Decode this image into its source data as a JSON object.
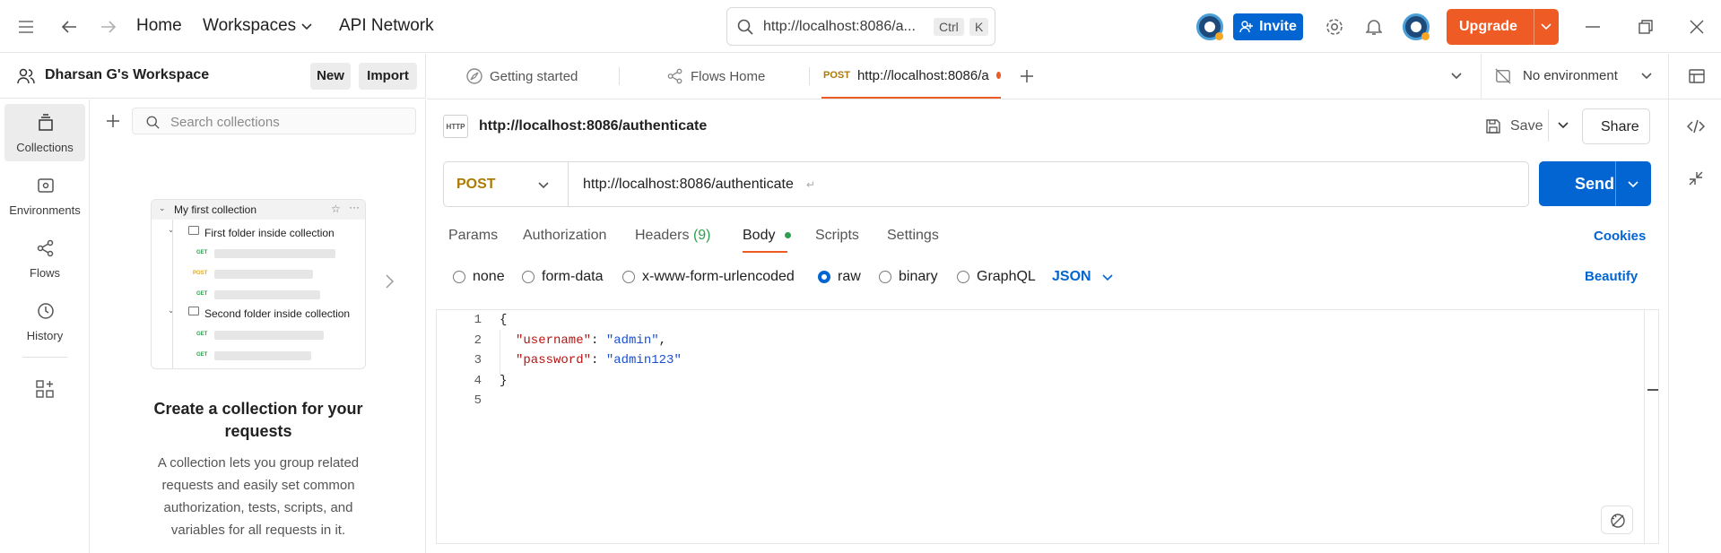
{
  "topbar": {
    "home": "Home",
    "workspaces": "Workspaces",
    "api_network": "API Network",
    "search_text": "http://localhost:8086/a...",
    "kbd_ctrl": "Ctrl",
    "kbd_k": "K",
    "invite": "Invite",
    "upgrade": "Upgrade",
    "accent_color": "#ef5b25",
    "primary_color": "#0265d2"
  },
  "rail": {
    "items": [
      {
        "label": "Collections",
        "icon": "collections-icon"
      },
      {
        "label": "Environments",
        "icon": "environments-icon"
      },
      {
        "label": "Flows",
        "icon": "flows-icon"
      },
      {
        "label": "History",
        "icon": "history-icon"
      }
    ]
  },
  "sidebar": {
    "workspace_name": "Dharsan G's Workspace",
    "new_label": "New",
    "import_label": "Import",
    "search_placeholder": "Search collections",
    "illustration": {
      "collection": "My first collection",
      "folder1": "First folder inside collection",
      "folder2": "Second folder inside collection",
      "get": "GET",
      "post": "POST"
    },
    "empty_title": "Create a collection for your requests",
    "empty_desc": "A collection lets you group related requests and easily set common authorization, tests, scripts, and variables for all requests in it."
  },
  "tabs": {
    "items": [
      {
        "label": "Getting started"
      },
      {
        "label": "Flows Home"
      },
      {
        "method": "POST",
        "label": "http://localhost:8086/a"
      }
    ],
    "environment": "No environment"
  },
  "request": {
    "title": "http://localhost:8086/authenticate",
    "save": "Save",
    "share": "Share",
    "method": "POST",
    "url": "http://localhost:8086/authenticate",
    "send": "Send",
    "subtabs": {
      "params": "Params",
      "authorization": "Authorization",
      "headers": "Headers",
      "headers_count": "(9)",
      "body": "Body",
      "scripts": "Scripts",
      "settings": "Settings"
    },
    "cookies": "Cookies",
    "body_types": [
      "none",
      "form-data",
      "x-www-form-urlencoded",
      "raw",
      "binary",
      "GraphQL"
    ],
    "body_format": "JSON",
    "beautify": "Beautify",
    "code": {
      "line_numbers": [
        "1",
        "2",
        "3",
        "4",
        "5"
      ],
      "open_brace": "{",
      "close_brace": "}",
      "key1": "\"username\"",
      "val1": "\"admin\"",
      "key2": "\"password\"",
      "val2": "\"admin123\""
    }
  }
}
